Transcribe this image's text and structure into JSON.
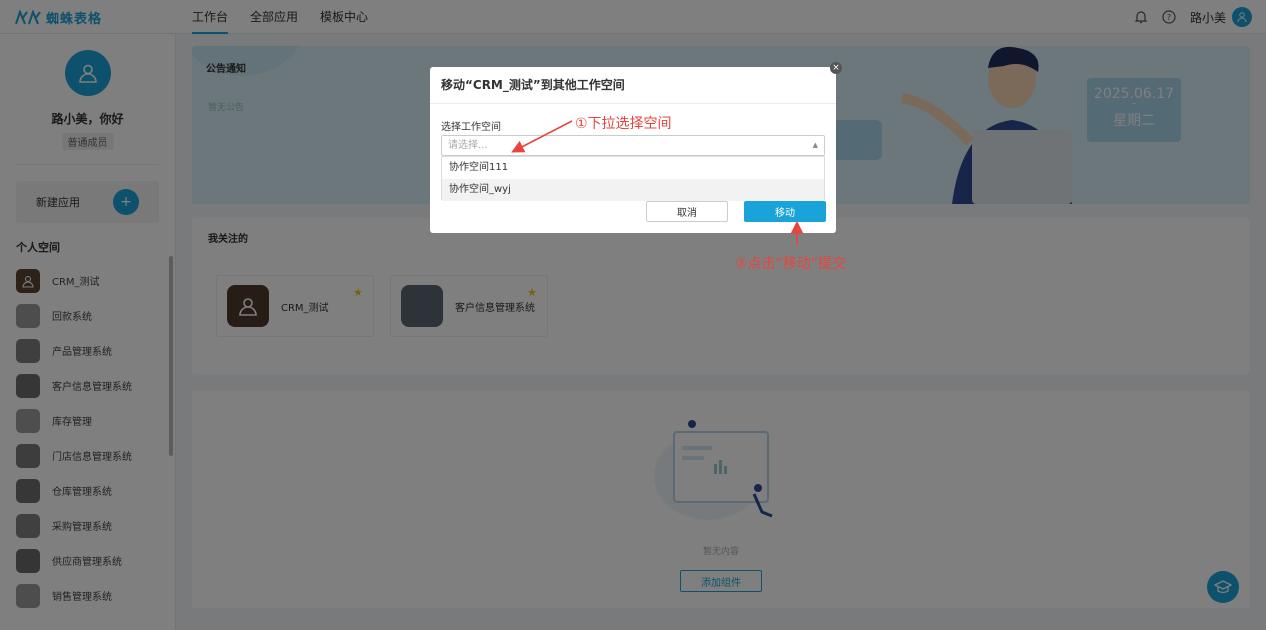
{
  "app": {
    "logo_text": "蜘蛛表格",
    "brand_color": "#1aa3d9"
  },
  "topnav": {
    "tabs": [
      {
        "label": "工作台",
        "active": true
      },
      {
        "label": "全部应用"
      },
      {
        "label": "模板中心"
      }
    ]
  },
  "header_right": {
    "bell_icon": "bell-icon",
    "help_icon": "help-icon",
    "user_name": "路小美"
  },
  "sidebar": {
    "greeting": "路小美，你好",
    "role": "普通成员",
    "new_app_label": "新建应用",
    "new_app_plus": "+",
    "section_title": "个人空间",
    "apps": [
      {
        "label": "CRM_测试"
      },
      {
        "label": "回款系统"
      },
      {
        "label": "产品管理系统"
      },
      {
        "label": "客户信息管理系统"
      },
      {
        "label": "库存管理"
      },
      {
        "label": "门店信息管理系统"
      },
      {
        "label": "仓库管理系统"
      },
      {
        "label": "采购管理系统"
      },
      {
        "label": "供应商管理系统"
      },
      {
        "label": "销售管理系统"
      }
    ]
  },
  "banner": {
    "title": "公告通知",
    "subtitle": "暂无公告",
    "date": "2025.06.17",
    "dash": "–",
    "weekday": "星期二"
  },
  "followed": {
    "title": "我关注的",
    "items": [
      {
        "label": "CRM_测试"
      },
      {
        "label": "客户信息管理系统"
      }
    ]
  },
  "widgets": {
    "empty_text": "暂无内容",
    "add_button": "添加组件"
  },
  "dialog": {
    "title": "移动“CRM_测试”到其他工作空间",
    "close": "×",
    "field_label": "选择工作空间",
    "placeholder": "请选择...",
    "options": [
      "协作空间111",
      "协作空间_wyj"
    ],
    "cancel_label": "取消",
    "move_label": "移动"
  },
  "annotations": {
    "step1": "①下拉选择空间",
    "step2": "②点击“移动”提交",
    "color": "#e8453c"
  }
}
